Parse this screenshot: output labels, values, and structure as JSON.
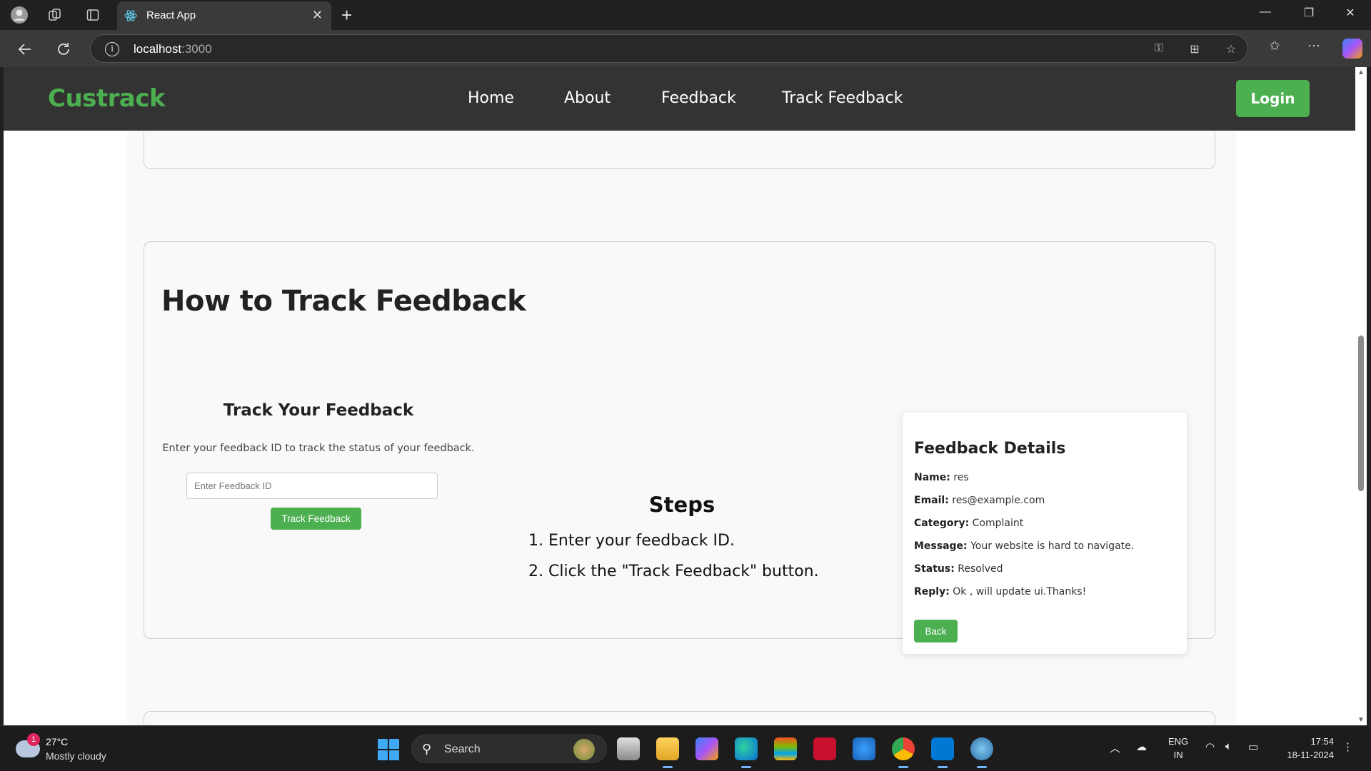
{
  "browser": {
    "tab_title": "React App",
    "url_host": "localhost",
    "url_port": ":3000"
  },
  "site": {
    "logo": "Custrack",
    "nav": [
      "Home",
      "About",
      "Feedback",
      "Track Feedback"
    ],
    "login_label": "Login",
    "accent_color": "#4caf50"
  },
  "how_to": {
    "title": "How to Track Feedback"
  },
  "track_form": {
    "heading": "Track Your Feedback",
    "description": "Enter your feedback ID to track the status of your feedback.",
    "input_placeholder": "Enter Feedback ID",
    "button_label": "Track Feedback"
  },
  "steps": {
    "heading": "Steps",
    "items": [
      "1. Enter your feedback ID.",
      "2. Click the \"Track Feedback\" button."
    ]
  },
  "details": {
    "heading": "Feedback Details",
    "rows": [
      {
        "label": "Name:",
        "value": "res"
      },
      {
        "label": "Email:",
        "value": "res@example.com"
      },
      {
        "label": "Category:",
        "value": "Complaint"
      },
      {
        "label": "Message:",
        "value": "Your website is hard to navigate."
      },
      {
        "label": "Status:",
        "value": "Resolved"
      },
      {
        "label": "Reply:",
        "value": "Ok , will update ui.Thanks!"
      }
    ],
    "back_label": "Back"
  },
  "taskbar": {
    "weather_badge": "1",
    "temperature": "27°C",
    "weather": "Mostly cloudy",
    "search_label": "Search",
    "lang_top": "ENG",
    "lang_bottom": "IN",
    "time": "17:54",
    "date": "18-11-2024"
  }
}
